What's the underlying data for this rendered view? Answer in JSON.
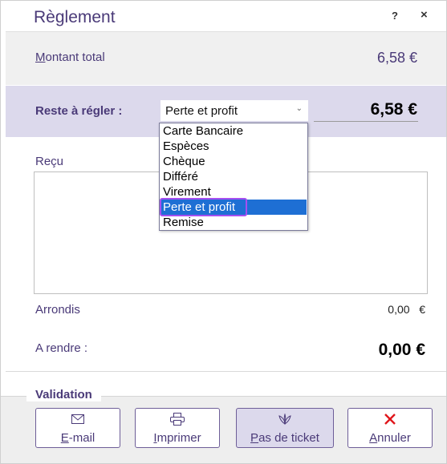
{
  "dialog": {
    "title": "Règlement",
    "help": "?",
    "close": "×"
  },
  "total": {
    "label_first": "M",
    "label_rest": "ontant total",
    "value": "6,58 €"
  },
  "remain": {
    "label": "Reste à régler :",
    "selected_method": "Perte et profit",
    "value": "6,58 €"
  },
  "dropdown": {
    "options": [
      "Carte Bancaire",
      "Espèces",
      "Chèque",
      "Différé",
      "Virement",
      "Perte et profit",
      "Remise"
    ],
    "selected_index": 5
  },
  "recu": {
    "label": "Reçu"
  },
  "arrondis": {
    "label": "Arrondis",
    "value": "0,00   €"
  },
  "rendre": {
    "label": "A rendre :",
    "value": "0,00 €"
  },
  "validation": {
    "label": "Validation",
    "buttons": {
      "email": {
        "first": "E",
        "rest": "-mail",
        "icon": "envelope-icon"
      },
      "print": {
        "first": "I",
        "rest": "mprimer",
        "icon": "printer-icon"
      },
      "noticket": {
        "first": "P",
        "rest": "as de ticket",
        "icon": "leaf-icon"
      },
      "cancel": {
        "first": "A",
        "rest": "nnuler",
        "icon": "cross-icon"
      }
    }
  },
  "colors": {
    "accent": "#4a3a78",
    "highlight_panel": "#dcd9ec",
    "selection": "#1e6fd4",
    "focus_outline": "#a64ff0",
    "cancel_red": "#e0161b"
  }
}
